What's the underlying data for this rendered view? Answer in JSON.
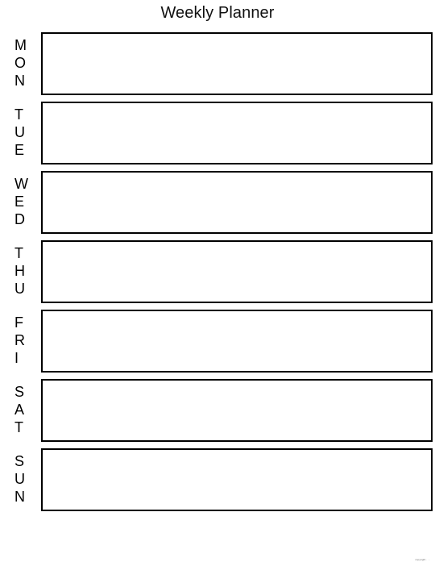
{
  "document": {
    "title": "Weekly Planner"
  },
  "days": [
    {
      "name": "mon",
      "label": "MON",
      "letters": [
        "M",
        "O",
        "N"
      ],
      "note": ""
    },
    {
      "name": "tue",
      "label": "TUE",
      "letters": [
        "T",
        "U",
        "E"
      ],
      "note": ""
    },
    {
      "name": "wed",
      "label": "WED",
      "letters": [
        "W",
        "E",
        "D"
      ],
      "note": ""
    },
    {
      "name": "thu",
      "label": "THU",
      "letters": [
        "T",
        "H",
        "U"
      ],
      "note": ""
    },
    {
      "name": "fri",
      "label": "FRI",
      "letters": [
        "F",
        "R",
        "I"
      ],
      "note": ""
    },
    {
      "name": "sat",
      "label": "SAT",
      "letters": [
        "S",
        "A",
        "T"
      ],
      "note": ""
    },
    {
      "name": "sun",
      "label": "SUN",
      "letters": [
        "S",
        "U",
        "N"
      ],
      "note": ""
    }
  ],
  "footer": {
    "watermark": "copyright . . ."
  },
  "colors": {
    "page_background": "#ffffff",
    "box_border": "#000000",
    "text": "#000000",
    "watermark": "#6b6b6b"
  }
}
